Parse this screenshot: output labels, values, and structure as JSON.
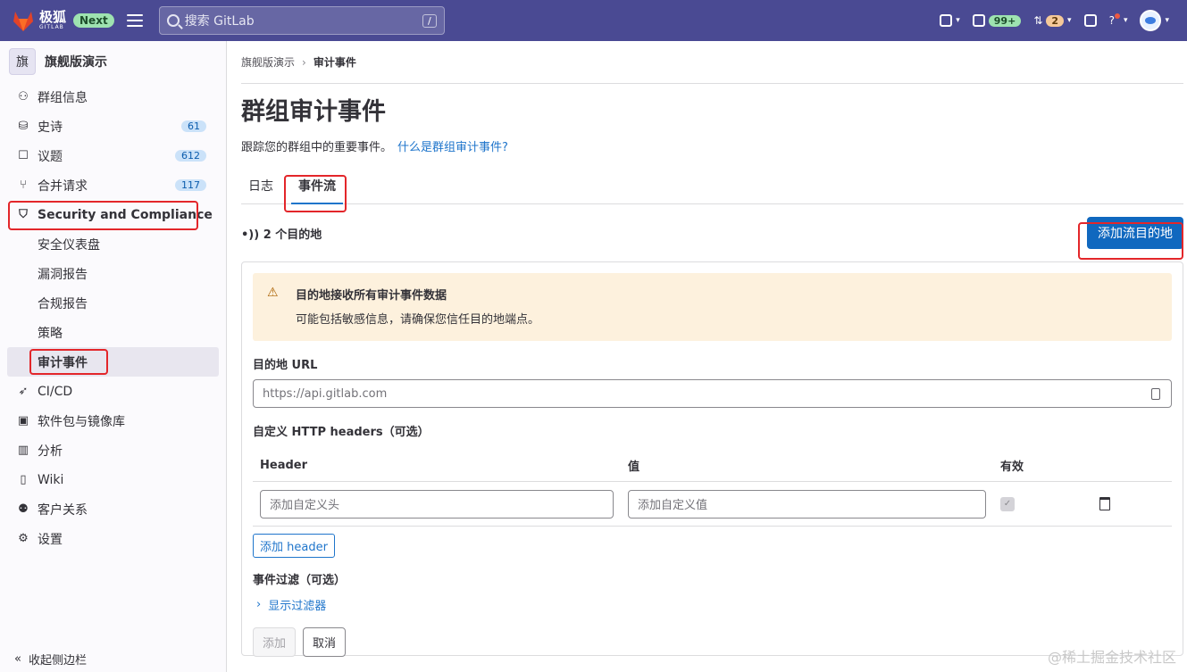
{
  "topbar": {
    "brand_cn": "极狐",
    "brand_en": "GITLAB",
    "next_badge": "Next",
    "search_placeholder": "搜索 GitLab",
    "search_shortcut": "/",
    "todo_count": "99+",
    "mr_count": "2"
  },
  "sidebar": {
    "group_initial": "旗",
    "group_name": "旗舰版演示",
    "items": [
      {
        "label": "群组信息"
      },
      {
        "label": "史诗",
        "count": "61"
      },
      {
        "label": "议题",
        "count": "612"
      },
      {
        "label": "合并请求",
        "count": "117"
      },
      {
        "label": "Security and Compliance"
      },
      {
        "label": "安全仪表盘"
      },
      {
        "label": "漏洞报告"
      },
      {
        "label": "合规报告"
      },
      {
        "label": "策略"
      },
      {
        "label": "审计事件"
      },
      {
        "label": "CI/CD"
      },
      {
        "label": "软件包与镜像库"
      },
      {
        "label": "分析"
      },
      {
        "label": "Wiki"
      },
      {
        "label": "客户关系"
      },
      {
        "label": "设置"
      }
    ],
    "collapse_label": "收起侧边栏"
  },
  "breadcrumb": {
    "parent": "旗舰版演示",
    "current": "审计事件"
  },
  "page": {
    "title": "群组审计事件",
    "description": "跟踪您的群组中的重要事件。",
    "help_link": "什么是群组审计事件?",
    "tabs": [
      "日志",
      "事件流"
    ],
    "destinations_count": "2 个目的地",
    "add_destination_button": "添加流目的地"
  },
  "form": {
    "alert_title": "目的地接收所有审计事件数据",
    "alert_body": "可能包括敏感信息，请确保您信任目的地端点。",
    "url_label": "目的地 URL",
    "url_placeholder": "https://api.gitlab.com",
    "headers_label": "自定义 HTTP headers（可选）",
    "col_header": "Header",
    "col_value": "值",
    "col_active": "有效",
    "header_placeholder": "添加自定义头",
    "value_placeholder": "添加自定义值",
    "add_header_button": "添加 header",
    "filters_label": "事件过滤（可选）",
    "show_filters": "显示过滤器",
    "submit_button": "添加",
    "cancel_button": "取消"
  },
  "watermark": "@稀土掘金技术社区",
  "colors": {
    "topbar": "#4a4a93",
    "primary": "#1068bf",
    "highlight": "#e3262a",
    "alert_bg": "#fdf1dd"
  }
}
